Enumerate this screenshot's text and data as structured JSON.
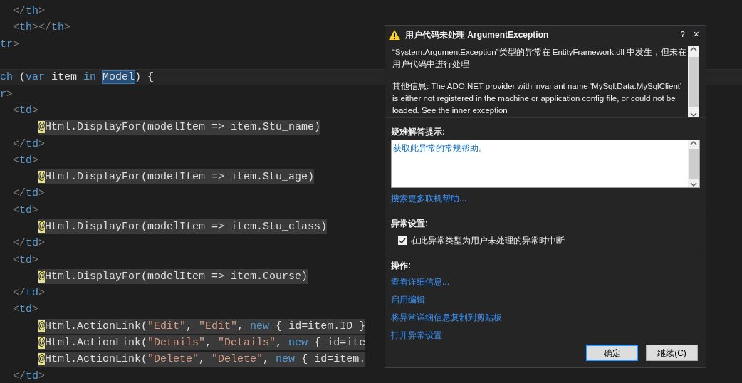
{
  "editor": {
    "lines": [
      {
        "kind": "markup",
        "tokens": [
          {
            "kind": "punct",
            "text": "</"
          },
          {
            "kind": "tag",
            "text": "th"
          },
          {
            "kind": "punct",
            "text": ">"
          }
        ]
      },
      {
        "kind": "markup",
        "tokens": [
          {
            "kind": "punct",
            "text": "<"
          },
          {
            "kind": "tag",
            "text": "th"
          },
          {
            "kind": "punct",
            "text": "></"
          },
          {
            "kind": "tag",
            "text": "th"
          },
          {
            "kind": "punct",
            "text": ">"
          }
        ]
      },
      {
        "kind": "edge",
        "tokens": [
          {
            "kind": "tag",
            "text": "tr"
          },
          {
            "kind": "punct",
            "text": ">"
          }
        ]
      },
      {
        "kind": "edge"
      },
      {
        "kind": "edge",
        "current": true,
        "tokens": [
          {
            "kind": "keyword",
            "text": "ch"
          },
          {
            "kind": "text",
            "text": " ("
          },
          {
            "kind": "keyword",
            "text": "var"
          },
          {
            "kind": "text",
            "text": " item "
          },
          {
            "kind": "keyword",
            "text": "in "
          },
          {
            "kind": "selection",
            "text": "Model"
          },
          {
            "kind": "text",
            "text": ") {"
          }
        ]
      },
      {
        "kind": "edge",
        "tokens": [
          {
            "kind": "tag",
            "text": "r"
          },
          {
            "kind": "punct",
            "text": ">"
          }
        ]
      },
      {
        "kind": "markup",
        "tokens": [
          {
            "kind": "punct",
            "text": "<"
          },
          {
            "kind": "tag",
            "text": "td"
          },
          {
            "kind": "punct",
            "text": ">"
          }
        ]
      },
      {
        "kind": "razor",
        "razor": true,
        "tokens": [
          {
            "kind": "at",
            "text": "@"
          },
          {
            "kind": "text",
            "text": "Html.DisplayFor(modelItem => item.Stu_name)"
          }
        ]
      },
      {
        "kind": "markup",
        "tokens": [
          {
            "kind": "punct",
            "text": "</"
          },
          {
            "kind": "tag",
            "text": "td"
          },
          {
            "kind": "punct",
            "text": ">"
          }
        ]
      },
      {
        "kind": "markup",
        "tokens": [
          {
            "kind": "punct",
            "text": "<"
          },
          {
            "kind": "tag",
            "text": "td"
          },
          {
            "kind": "punct",
            "text": ">"
          }
        ]
      },
      {
        "kind": "razor",
        "razor": true,
        "tokens": [
          {
            "kind": "at",
            "text": "@"
          },
          {
            "kind": "text",
            "text": "Html.DisplayFor(modelItem => item.Stu_age)"
          }
        ]
      },
      {
        "kind": "markup",
        "tokens": [
          {
            "kind": "punct",
            "text": "</"
          },
          {
            "kind": "tag",
            "text": "td"
          },
          {
            "kind": "punct",
            "text": ">"
          }
        ]
      },
      {
        "kind": "markup",
        "tokens": [
          {
            "kind": "punct",
            "text": "<"
          },
          {
            "kind": "tag",
            "text": "td"
          },
          {
            "kind": "punct",
            "text": ">"
          }
        ]
      },
      {
        "kind": "razor",
        "razor": true,
        "tokens": [
          {
            "kind": "at",
            "text": "@"
          },
          {
            "kind": "text",
            "text": "Html.DisplayFor(modelItem => item.Stu_class)"
          }
        ]
      },
      {
        "kind": "markup",
        "tokens": [
          {
            "kind": "punct",
            "text": "</"
          },
          {
            "kind": "tag",
            "text": "td"
          },
          {
            "kind": "punct",
            "text": ">"
          }
        ]
      },
      {
        "kind": "markup",
        "tokens": [
          {
            "kind": "punct",
            "text": "<"
          },
          {
            "kind": "tag",
            "text": "td"
          },
          {
            "kind": "punct",
            "text": ">"
          }
        ]
      },
      {
        "kind": "razor",
        "razor": true,
        "tokens": [
          {
            "kind": "at",
            "text": "@"
          },
          {
            "kind": "text",
            "text": "Html.DisplayFor(modelItem => item.Course)"
          }
        ]
      },
      {
        "kind": "markup",
        "tokens": [
          {
            "kind": "punct",
            "text": "</"
          },
          {
            "kind": "tag",
            "text": "td"
          },
          {
            "kind": "punct",
            "text": ">"
          }
        ]
      },
      {
        "kind": "markup",
        "tokens": [
          {
            "kind": "punct",
            "text": "<"
          },
          {
            "kind": "tag",
            "text": "td"
          },
          {
            "kind": "punct",
            "text": ">"
          }
        ]
      },
      {
        "kind": "razor",
        "razor": true,
        "tokens": [
          {
            "kind": "at",
            "text": "@"
          },
          {
            "kind": "text",
            "text": "Html.ActionLink("
          },
          {
            "kind": "string",
            "text": "\"Edit\""
          },
          {
            "kind": "text",
            "text": ", "
          },
          {
            "kind": "string",
            "text": "\"Edit\""
          },
          {
            "kind": "text",
            "text": ", "
          },
          {
            "kind": "keyword",
            "text": "new"
          },
          {
            "kind": "text",
            "text": " { id=item.ID }"
          }
        ]
      },
      {
        "kind": "razor",
        "razor": true,
        "tokens": [
          {
            "kind": "at",
            "text": "@"
          },
          {
            "kind": "text",
            "text": "Html.ActionLink("
          },
          {
            "kind": "string",
            "text": "\"Details\""
          },
          {
            "kind": "text",
            "text": ", "
          },
          {
            "kind": "string",
            "text": "\"Details\""
          },
          {
            "kind": "text",
            "text": ", "
          },
          {
            "kind": "keyword",
            "text": "new"
          },
          {
            "kind": "text",
            "text": " { id=ite"
          }
        ]
      },
      {
        "kind": "razor",
        "razor": true,
        "tokens": [
          {
            "kind": "at",
            "text": "@"
          },
          {
            "kind": "text",
            "text": "Html.ActionLink("
          },
          {
            "kind": "string",
            "text": "\"Delete\""
          },
          {
            "kind": "text",
            "text": ", "
          },
          {
            "kind": "string",
            "text": "\"Delete\""
          },
          {
            "kind": "text",
            "text": ", "
          },
          {
            "kind": "keyword",
            "text": "new"
          },
          {
            "kind": "text",
            "text": " { id=item."
          }
        ]
      },
      {
        "kind": "markup",
        "tokens": [
          {
            "kind": "punct",
            "text": "</"
          },
          {
            "kind": "tag",
            "text": "td"
          },
          {
            "kind": "punct",
            "text": ">"
          }
        ]
      }
    ]
  },
  "dialog": {
    "title": "用户代码未处理 ArgumentException",
    "help": "?",
    "close": "×",
    "message": [
      "“System.ArgumentException”类型的异常在 EntityFramework.dll 中发生，但未在用户代码中进行处理",
      "其他信息: The ADO.NET provider with invariant name 'MySql.Data.MySqlClient' is either not registered in the machine or application config file, or could not be loaded. See the inner exception"
    ],
    "troubleshooting": {
      "heading": "疑难解答提示:",
      "tips": [
        "获取此异常的常规帮助。"
      ]
    },
    "search_link": "搜索更多联机帮助...",
    "settings": {
      "heading": "异常设置:",
      "checkbox": {
        "label": "在此异常类型为用户未处理的异常时中断",
        "checked": true
      }
    },
    "actions": {
      "heading": "操作:",
      "links": [
        "查看详细信息...",
        "启用编辑",
        "将异常详细信息复制到剪贴板",
        "打开异常设置"
      ]
    },
    "buttons": [
      {
        "label": "确定",
        "default": true
      },
      {
        "label": "继续(C)",
        "default": false
      }
    ]
  }
}
